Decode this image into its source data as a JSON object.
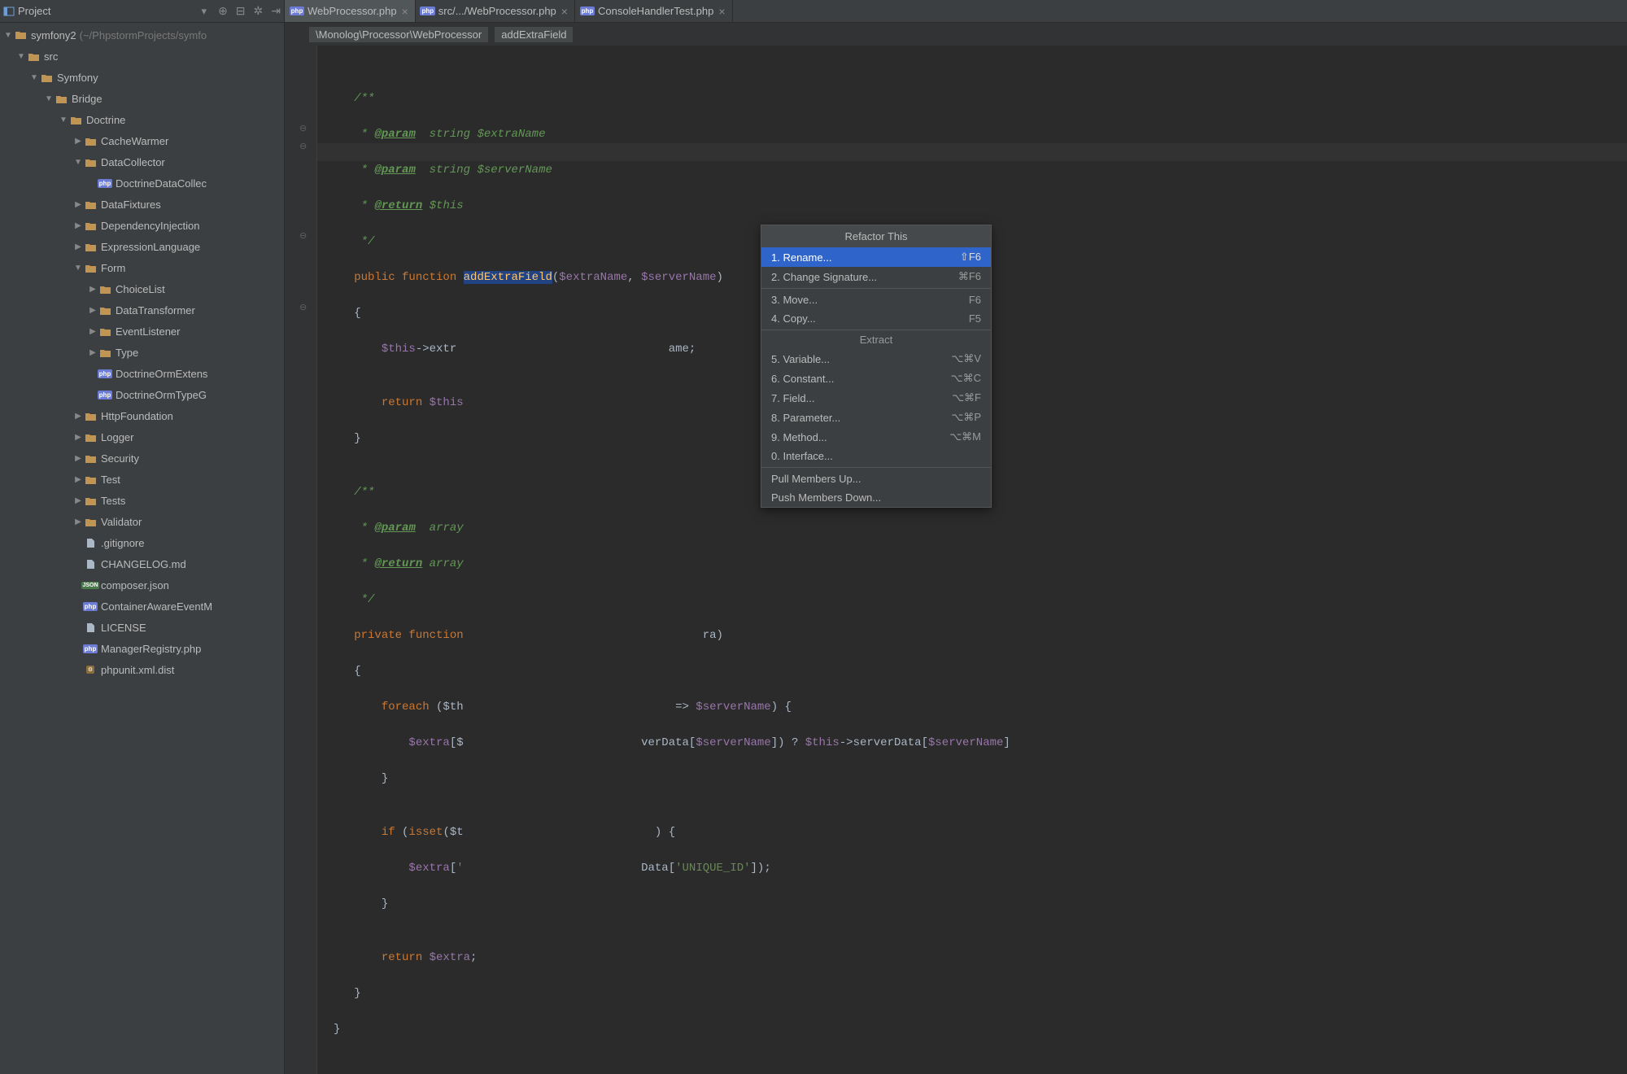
{
  "sidebar": {
    "title": "Project",
    "root": {
      "label": "symfony2",
      "extra": "(~/PhpstormProjects/symfo"
    },
    "nodes": [
      {
        "indent": 1,
        "arrow": "open",
        "icon": "folder",
        "label": "src"
      },
      {
        "indent": 2,
        "arrow": "open",
        "icon": "folder",
        "label": "Symfony"
      },
      {
        "indent": 3,
        "arrow": "open",
        "icon": "folder",
        "label": "Bridge"
      },
      {
        "indent": 4,
        "arrow": "open",
        "icon": "folder",
        "label": "Doctrine"
      },
      {
        "indent": 5,
        "arrow": "closed",
        "icon": "folder",
        "label": "CacheWarmer"
      },
      {
        "indent": 5,
        "arrow": "open",
        "icon": "folder",
        "label": "DataCollector"
      },
      {
        "indent": 6,
        "arrow": "none",
        "icon": "php",
        "label": "DoctrineDataCollec"
      },
      {
        "indent": 5,
        "arrow": "closed",
        "icon": "folder",
        "label": "DataFixtures"
      },
      {
        "indent": 5,
        "arrow": "closed",
        "icon": "folder",
        "label": "DependencyInjection"
      },
      {
        "indent": 5,
        "arrow": "closed",
        "icon": "folder",
        "label": "ExpressionLanguage"
      },
      {
        "indent": 5,
        "arrow": "open",
        "icon": "folder",
        "label": "Form"
      },
      {
        "indent": 6,
        "arrow": "closed",
        "icon": "folder",
        "label": "ChoiceList"
      },
      {
        "indent": 6,
        "arrow": "closed",
        "icon": "folder",
        "label": "DataTransformer"
      },
      {
        "indent": 6,
        "arrow": "closed",
        "icon": "folder",
        "label": "EventListener"
      },
      {
        "indent": 6,
        "arrow": "closed",
        "icon": "folder",
        "label": "Type"
      },
      {
        "indent": 6,
        "arrow": "none",
        "icon": "php",
        "label": "DoctrineOrmExtens"
      },
      {
        "indent": 6,
        "arrow": "none",
        "icon": "php",
        "label": "DoctrineOrmTypeG"
      },
      {
        "indent": 5,
        "arrow": "closed",
        "icon": "folder",
        "label": "HttpFoundation"
      },
      {
        "indent": 5,
        "arrow": "closed",
        "icon": "folder",
        "label": "Logger"
      },
      {
        "indent": 5,
        "arrow": "closed",
        "icon": "folder",
        "label": "Security"
      },
      {
        "indent": 5,
        "arrow": "closed",
        "icon": "folder",
        "label": "Test"
      },
      {
        "indent": 5,
        "arrow": "closed",
        "icon": "folder",
        "label": "Tests"
      },
      {
        "indent": 5,
        "arrow": "closed",
        "icon": "folder",
        "label": "Validator"
      },
      {
        "indent": 5,
        "arrow": "none",
        "icon": "file",
        "label": ".gitignore"
      },
      {
        "indent": 5,
        "arrow": "none",
        "icon": "file",
        "label": "CHANGELOG.md"
      },
      {
        "indent": 5,
        "arrow": "none",
        "icon": "json",
        "label": "composer.json"
      },
      {
        "indent": 5,
        "arrow": "none",
        "icon": "php",
        "label": "ContainerAwareEventM"
      },
      {
        "indent": 5,
        "arrow": "none",
        "icon": "file",
        "label": "LICENSE"
      },
      {
        "indent": 5,
        "arrow": "none",
        "icon": "php",
        "label": "ManagerRegistry.php"
      },
      {
        "indent": 5,
        "arrow": "none",
        "icon": "xml",
        "label": "phpunit.xml.dist"
      }
    ]
  },
  "tabs": [
    {
      "icon": "php",
      "label": "WebProcessor.php",
      "active": true
    },
    {
      "icon": "php",
      "label": "src/.../WebProcessor.php",
      "active": false
    },
    {
      "icon": "php",
      "label": "ConsoleHandlerTest.php",
      "active": false
    }
  ],
  "breadcrumb": [
    "\\Monolog\\Processor\\WebProcessor",
    "addExtraField"
  ],
  "code": {
    "l1": "/**",
    "l2a": " * ",
    "l2b": "@param",
    "l2c": "  string $extraName",
    "l3a": " * ",
    "l3b": "@param",
    "l3c": "  string $serverName",
    "l4a": " * ",
    "l4b": "@return",
    "l4c": " $this",
    "l5": " */",
    "l6a": "public function ",
    "l6b": "addExtraField",
    "l6c": "(",
    "l6d": "$extraName",
    "l6e": ", ",
    "l6f": "$serverName",
    "l6g": ")",
    "l7": "{",
    "l8a": "$this",
    "l8b": "->extr",
    "l8c": "ame;",
    "l9": "",
    "l10a": "return ",
    "l10b": "$this",
    "l11": "}",
    "l12": "",
    "l13": "/**",
    "l14a": " * ",
    "l14b": "@param",
    "l14c": "  array",
    "l15a": " * ",
    "l15b": "@return",
    "l15c": " array",
    "l16": " */",
    "l17a": "private function",
    "l17c": "ra)",
    "l18": "{",
    "l19a": "foreach ",
    "l19b": "($th",
    "l19c": " => ",
    "l19d": "$serverName",
    "l19e": ") {",
    "l20a": "$extra",
    "l20b": "[$",
    "l20c": "verData[",
    "l20d": "$serverName",
    "l20e": "]) ? ",
    "l20f": "$this",
    "l20g": "->serverData[",
    "l20h": "$serverName",
    "l20i": "]",
    "l21": "}",
    "l22": "",
    "l23a": "if ",
    "l23b": "(",
    "l23c": "isset",
    "l23d": "($t",
    "l23e": ") {",
    "l24a": "$extra",
    "l24b": "[",
    "l24c": "'",
    "l24d": "Data[",
    "l24e": "'UNIQUE_ID'",
    "l24f": "]);",
    "l25": "}",
    "l26": "",
    "l27a": "return ",
    "l27b": "$extra",
    "l27c": ";",
    "l28": "}",
    "l29": "}"
  },
  "popup": {
    "title": "Refactor This",
    "items1": [
      {
        "label": "1. Rename...",
        "shortcut": "⇧F6",
        "selected": true
      },
      {
        "label": "2. Change Signature...",
        "shortcut": "⌘F6"
      }
    ],
    "items2": [
      {
        "label": "3. Move...",
        "shortcut": "F6"
      },
      {
        "label": "4. Copy...",
        "shortcut": "F5"
      }
    ],
    "section": "Extract",
    "items3": [
      {
        "label": "5. Variable...",
        "shortcut": "⌥⌘V"
      },
      {
        "label": "6. Constant...",
        "shortcut": "⌥⌘C"
      },
      {
        "label": "7. Field...",
        "shortcut": "⌥⌘F"
      },
      {
        "label": "8. Parameter...",
        "shortcut": "⌥⌘P"
      },
      {
        "label": "9. Method...",
        "shortcut": "⌥⌘M"
      },
      {
        "label": "0. Interface..."
      }
    ],
    "items4": [
      {
        "label": "Pull Members Up..."
      },
      {
        "label": "Push Members Down..."
      }
    ]
  }
}
